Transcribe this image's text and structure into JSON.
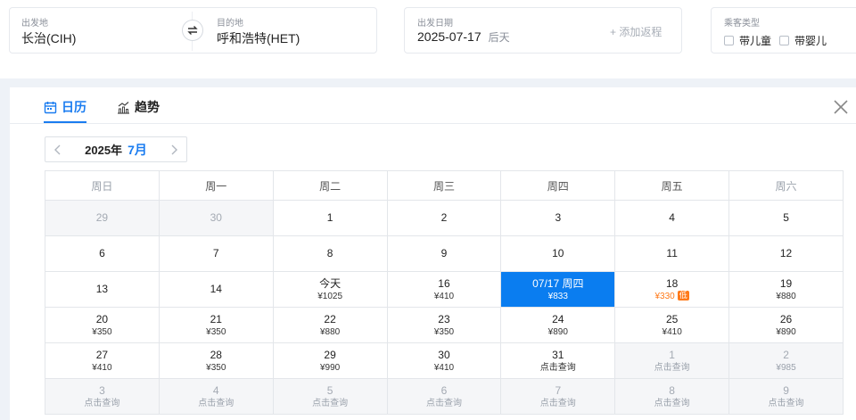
{
  "search": {
    "from_label": "出发地",
    "from_value": "长治(CIH)",
    "to_label": "目的地",
    "to_value": "呼和浩特(HET)",
    "date_label": "出发日期",
    "date_value": "2025-07-17",
    "date_note": "后天",
    "add_return": "+ 添加返程",
    "pass_label": "乘客类型",
    "child_label": "带儿童",
    "infant_label": "带婴儿"
  },
  "tabs": {
    "calendar": "日历",
    "trend": "趋势"
  },
  "month": {
    "year": "2025年",
    "month": "7月"
  },
  "weekdays": [
    "周日",
    "周一",
    "周二",
    "周三",
    "周四",
    "周五",
    "周六"
  ],
  "weeks": [
    [
      {
        "d": "29",
        "p": "",
        "state": "muted"
      },
      {
        "d": "30",
        "p": "",
        "state": "muted"
      },
      {
        "d": "1",
        "p": ""
      },
      {
        "d": "2",
        "p": ""
      },
      {
        "d": "3",
        "p": ""
      },
      {
        "d": "4",
        "p": ""
      },
      {
        "d": "5",
        "p": ""
      }
    ],
    [
      {
        "d": "6",
        "p": ""
      },
      {
        "d": "7",
        "p": ""
      },
      {
        "d": "8",
        "p": ""
      },
      {
        "d": "9",
        "p": ""
      },
      {
        "d": "10",
        "p": ""
      },
      {
        "d": "11",
        "p": ""
      },
      {
        "d": "12",
        "p": ""
      }
    ],
    [
      {
        "d": "13",
        "p": ""
      },
      {
        "d": "14",
        "p": ""
      },
      {
        "d": "今天",
        "p": "¥1025"
      },
      {
        "d": "16",
        "p": "¥410"
      },
      {
        "d": "07/17 周四",
        "p": "¥833",
        "state": "sel"
      },
      {
        "d": "18",
        "p": "¥330",
        "state": "low",
        "tag": "低"
      },
      {
        "d": "19",
        "p": "¥880"
      }
    ],
    [
      {
        "d": "20",
        "p": "¥350"
      },
      {
        "d": "21",
        "p": "¥350"
      },
      {
        "d": "22",
        "p": "¥880"
      },
      {
        "d": "23",
        "p": "¥350"
      },
      {
        "d": "24",
        "p": "¥890"
      },
      {
        "d": "25",
        "p": "¥410"
      },
      {
        "d": "26",
        "p": "¥890"
      }
    ],
    [
      {
        "d": "27",
        "p": "¥410"
      },
      {
        "d": "28",
        "p": "¥350"
      },
      {
        "d": "29",
        "p": "¥990"
      },
      {
        "d": "30",
        "p": "¥410"
      },
      {
        "d": "31",
        "p": "点击查询"
      },
      {
        "d": "1",
        "p": "点击查询",
        "state": "muted"
      },
      {
        "d": "2",
        "p": "¥985",
        "state": "muted"
      }
    ],
    [
      {
        "d": "3",
        "p": "点击查询",
        "state": "muted"
      },
      {
        "d": "4",
        "p": "点击查询",
        "state": "muted"
      },
      {
        "d": "5",
        "p": "点击查询",
        "state": "muted"
      },
      {
        "d": "6",
        "p": "点击查询",
        "state": "muted"
      },
      {
        "d": "7",
        "p": "点击查询",
        "state": "muted"
      },
      {
        "d": "8",
        "p": "点击查询",
        "state": "muted"
      },
      {
        "d": "9",
        "p": "点击查询",
        "state": "muted"
      }
    ]
  ],
  "colors": {
    "accent": "#0a7df0",
    "low": "#ff7a1a"
  }
}
